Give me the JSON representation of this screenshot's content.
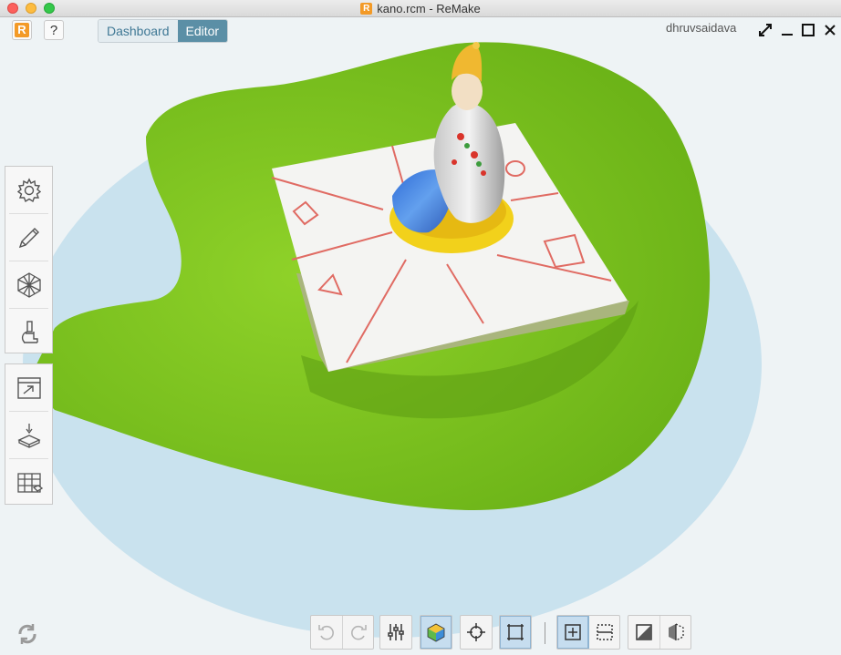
{
  "window": {
    "title": "kano.rcm - ReMake",
    "app_icon_letter": "R"
  },
  "toolbar_top": {
    "logo_letter": "R",
    "help_label": "?",
    "tabs": [
      {
        "label": "Dashboard",
        "active": false
      },
      {
        "label": "Editor",
        "active": true
      }
    ],
    "username": "dhruvsaidava"
  },
  "left_tools": {
    "group1": [
      "settings-icon",
      "pencil-icon",
      "mesh-icon",
      "microscope-icon"
    ],
    "group2": [
      "export-icon",
      "3d-print-icon",
      "materials-grid-icon"
    ]
  },
  "bottom_tools": [
    "undo-icon",
    "redo-icon",
    "sliders-icon",
    "shaded-cube-icon",
    "crosshair-icon",
    "frame-icon",
    "fit-selection-icon",
    "dotted-selection-icon",
    "section-icon",
    "half-cube-icon"
  ],
  "colors": {
    "ground_disk": "#c9e2ee",
    "mesh_green": "#7bc41f",
    "tab_active": "#5b8fa6",
    "tab_inactive_text": "#3f7895",
    "active_tool": "#c6ddef"
  }
}
